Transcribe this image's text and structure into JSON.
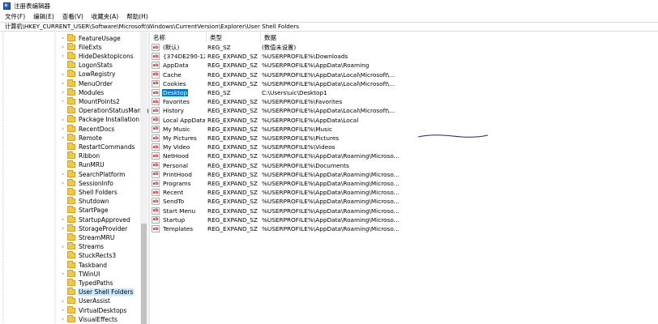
{
  "window": {
    "title": "注册表编辑器"
  },
  "menu": [
    {
      "label": "文件(F)"
    },
    {
      "label": "编辑(E)"
    },
    {
      "label": "查看(V)"
    },
    {
      "label": "收藏夹(A)"
    },
    {
      "label": "帮助(H)"
    }
  ],
  "address": {
    "path": "计算机\\HKEY_CURRENT_USER\\Software\\Microsoft\\Windows\\CurrentVersion\\Explorer\\User Shell Folders"
  },
  "tree": {
    "items": [
      {
        "label": "FeatureUsage",
        "expandable": true
      },
      {
        "label": "FileExts",
        "expandable": true
      },
      {
        "label": "HideDesktopIcons",
        "expandable": true
      },
      {
        "label": "LogonStats",
        "expandable": false
      },
      {
        "label": "LowRegistry",
        "expandable": true
      },
      {
        "label": "MenuOrder",
        "expandable": true
      },
      {
        "label": "Modules",
        "expandable": true
      },
      {
        "label": "MountPoints2",
        "expandable": true
      },
      {
        "label": "OperationStatusManager",
        "expandable": false
      },
      {
        "label": "Package Installation",
        "expandable": true
      },
      {
        "label": "RecentDocs",
        "expandable": true
      },
      {
        "label": "Remote",
        "expandable": true
      },
      {
        "label": "RestartCommands",
        "expandable": false
      },
      {
        "label": "Ribbon",
        "expandable": false
      },
      {
        "label": "RunMRU",
        "expandable": false
      },
      {
        "label": "SearchPlatform",
        "expandable": true
      },
      {
        "label": "SessionInfo",
        "expandable": true
      },
      {
        "label": "Shell Folders",
        "expandable": false
      },
      {
        "label": "Shutdown",
        "expandable": false
      },
      {
        "label": "StartPage",
        "expandable": false
      },
      {
        "label": "StartupApproved",
        "expandable": true
      },
      {
        "label": "StorageProvider",
        "expandable": true
      },
      {
        "label": "StreamMRU",
        "expandable": false
      },
      {
        "label": "Streams",
        "expandable": true
      },
      {
        "label": "StuckRects3",
        "expandable": false
      },
      {
        "label": "Taskband",
        "expandable": false
      },
      {
        "label": "TWinUI",
        "expandable": true
      },
      {
        "label": "TypedPaths",
        "expandable": false
      },
      {
        "label": "User Shell Folders",
        "expandable": false,
        "selected": true
      },
      {
        "label": "UserAssist",
        "expandable": true
      },
      {
        "label": "VirtualDesktops",
        "expandable": true
      },
      {
        "label": "VisualEffects",
        "expandable": true
      }
    ]
  },
  "list": {
    "columns": {
      "name": "名称",
      "type": "类型",
      "data": "数据"
    },
    "rows": [
      {
        "name": "(默认)",
        "type": "REG_SZ",
        "data": "(数值未设置)"
      },
      {
        "name": "{374DE290-12...",
        "type": "REG_EXPAND_SZ",
        "data": "%USERPROFILE%\\Downloads"
      },
      {
        "name": "AppData",
        "type": "REG_EXPAND_SZ",
        "data": "%USERPROFILE%\\AppData\\Roaming"
      },
      {
        "name": "Cache",
        "type": "REG_EXPAND_SZ",
        "data": "%USERPROFILE%\\AppData\\Local\\Microsoft\\..."
      },
      {
        "name": "Cookies",
        "type": "REG_EXPAND_SZ",
        "data": "%USERPROFILE%\\AppData\\Local\\Microsoft\\..."
      },
      {
        "name": "Desktop",
        "type": "REG_SZ",
        "data": "C:\\Users\\uic\\Desktop1",
        "selected": true
      },
      {
        "name": "Favorites",
        "type": "REG_EXPAND_SZ",
        "data": "%USERPROFILE%\\Favorites"
      },
      {
        "name": "History",
        "type": "REG_EXPAND_SZ",
        "data": "%USERPROFILE%\\AppData\\Local\\Microsoft\\..."
      },
      {
        "name": "Local AppData",
        "type": "REG_EXPAND_SZ",
        "data": "%USERPROFILE%\\AppData\\Local"
      },
      {
        "name": "My Music",
        "type": "REG_EXPAND_SZ",
        "data": "%USERPROFILE%\\Music"
      },
      {
        "name": "My Pictures",
        "type": "REG_EXPAND_SZ",
        "data": "%USERPROFILE%\\Pictures"
      },
      {
        "name": "My Video",
        "type": "REG_EXPAND_SZ",
        "data": "%USERPROFILE%\\Videos"
      },
      {
        "name": "NetHood",
        "type": "REG_EXPAND_SZ",
        "data": "%USERPROFILE%\\AppData\\Roaming\\Microso..."
      },
      {
        "name": "Personal",
        "type": "REG_EXPAND_SZ",
        "data": "%USERPROFILE%\\Documents"
      },
      {
        "name": "PrintHood",
        "type": "REG_EXPAND_SZ",
        "data": "%USERPROFILE%\\AppData\\Roaming\\Microso..."
      },
      {
        "name": "Programs",
        "type": "REG_EXPAND_SZ",
        "data": "%USERPROFILE%\\AppData\\Roaming\\Microso..."
      },
      {
        "name": "Recent",
        "type": "REG_EXPAND_SZ",
        "data": "%USERPROFILE%\\AppData\\Roaming\\Microso..."
      },
      {
        "name": "SendTo",
        "type": "REG_EXPAND_SZ",
        "data": "%USERPROFILE%\\AppData\\Roaming\\Microso..."
      },
      {
        "name": "Start Menu",
        "type": "REG_EXPAND_SZ",
        "data": "%USERPROFILE%\\AppData\\Roaming\\Microso..."
      },
      {
        "name": "Startup",
        "type": "REG_EXPAND_SZ",
        "data": "%USERPROFILE%\\AppData\\Roaming\\Microso..."
      },
      {
        "name": "Templates",
        "type": "REG_EXPAND_SZ",
        "data": "%USERPROFILE%\\AppData\\Roaming\\Microso..."
      }
    ]
  },
  "colors": {
    "selection": "#0078d7",
    "tree_selection": "#cce8ff",
    "annotation": "#1a2a6c"
  }
}
